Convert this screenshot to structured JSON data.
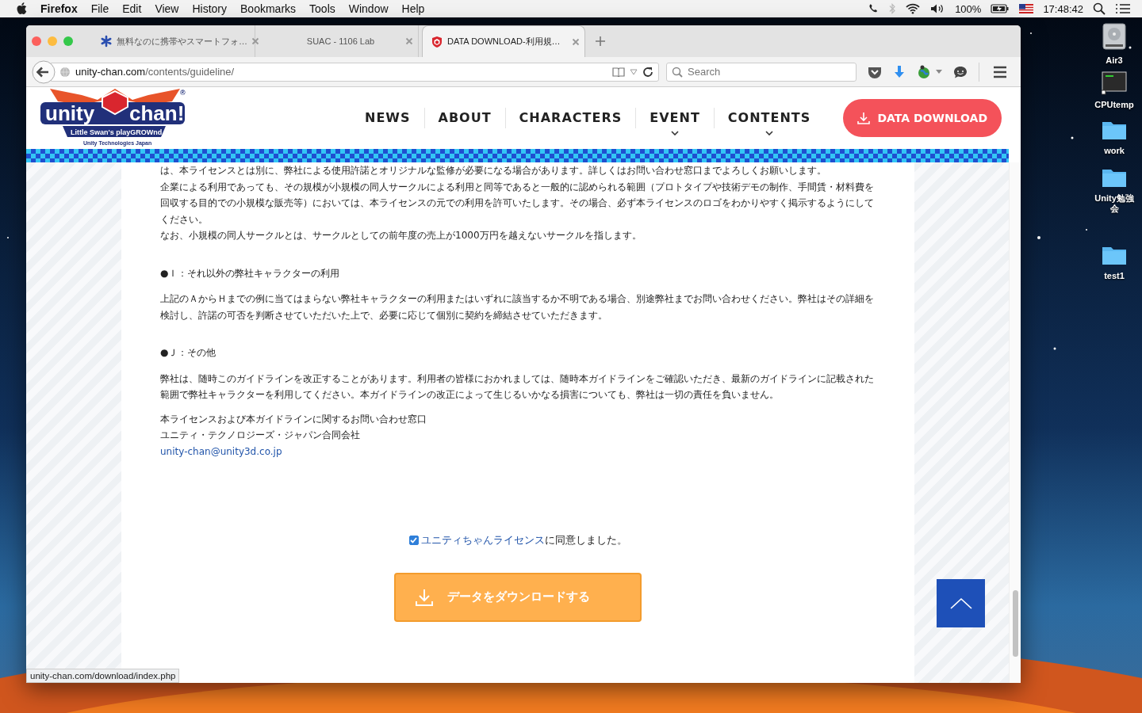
{
  "menu_bar": {
    "app": "Firefox",
    "items": [
      "File",
      "Edit",
      "View",
      "History",
      "Bookmarks",
      "Tools",
      "Window",
      "Help"
    ],
    "battery": "100%",
    "time": "17:48:42"
  },
  "desktop_icons": [
    {
      "label": "Air3",
      "kind": "drive"
    },
    {
      "label": "CPUtemp",
      "kind": "terminal"
    },
    {
      "label": "work",
      "kind": "folder"
    },
    {
      "label": "Unity勉強会",
      "kind": "folder"
    },
    {
      "label": "test1",
      "kind": "folder"
    }
  ],
  "browser": {
    "tabs": [
      {
        "title": "無料なのに携帯やスマートフォ…",
        "kind": "asterisk",
        "selected": false
      },
      {
        "title": "SUAC - 1106 Lab",
        "kind": "plain",
        "selected": false
      },
      {
        "title": "DATA DOWNLOAD-利用規…",
        "kind": "shield",
        "selected": true
      }
    ],
    "url": {
      "host": "unity-chan.com",
      "path": "/contents/guideline/"
    },
    "search": {
      "placeholder": "Search"
    },
    "status_url": "unity-chan.com/download/index.php"
  },
  "site": {
    "logo": {
      "word1": "unity",
      "word2": "chan!",
      "tagline": "Little Swan's playGROWnd",
      "company": "Unity Technologies Japan",
      "registered": "®"
    },
    "nav": [
      {
        "label": "NEWS",
        "submenu": false
      },
      {
        "label": "ABOUT",
        "submenu": false
      },
      {
        "label": "CHARACTERS",
        "submenu": false
      },
      {
        "label": "EVENT",
        "submenu": true
      },
      {
        "label": "CONTENTS",
        "submenu": true
      }
    ],
    "download_button": "DATA DOWNLOAD"
  },
  "content": [
    {
      "kind": "para",
      "text": "は、本ライセンスとは別に、弊社による使用許諾とオリジナルな監修が必要になる場合があります。詳しくはお問い合わせ窓口までよろしくお願いします。"
    },
    {
      "kind": "para",
      "text": "企業による利用であっても、その規模が小規模の同人サークルによる利用と同等であると一般的に認められる範囲（プロトタイプや技術デモの制作、手間賃・材料費を回収する目的での小規模な販売等）においては、本ライセンスの元での利用を許可いたします。その場合、必ず本ライセンスのロゴをわかりやすく掲示するようにしてください。"
    },
    {
      "kind": "para",
      "text": "なお、小規模の同人サークルとは、サークルとしての前年度の売上が1000万円を越えないサークルを指します。"
    },
    {
      "kind": "heading",
      "text": "●Ｉ：それ以外の弊社キャラクターの利用"
    },
    {
      "kind": "para",
      "text": "上記のＡからＨまでの例に当てはまらない弊社キャラクターの利用またはいずれに該当するか不明である場合、別途弊社までお問い合わせください。弊社はその詳細を検討し、許諾の可否を判断させていただいた上で、必要に応じて個別に契約を締結させていただきます。"
    },
    {
      "kind": "heading",
      "text": "●Ｊ：その他"
    },
    {
      "kind": "para",
      "text": "弊社は、随時このガイドラインを改正することがあります。利用者の皆様におかれましては、随時本ガイドラインをご確認いただき、最新のガイドラインに記載された範囲で弊社キャラクターを利用してください。本ガイドラインの改正によって生じるいかなる損害についても、弊社は一切の責任を負いません。"
    },
    {
      "kind": "contact",
      "text": "本ライセンスおよび本ガイドラインに関するお問い合わせ窓口"
    },
    {
      "kind": "contact",
      "text": "ユニティ・テクノロジーズ・ジャパン合同会社"
    },
    {
      "kind": "email",
      "text": "unity-chan@unity3d.co.jp"
    }
  ],
  "agree": {
    "checked": true,
    "link": "ユニティちゃんライセンス",
    "text": "に同意しました。"
  },
  "data_button": "データをダウンロードする"
}
